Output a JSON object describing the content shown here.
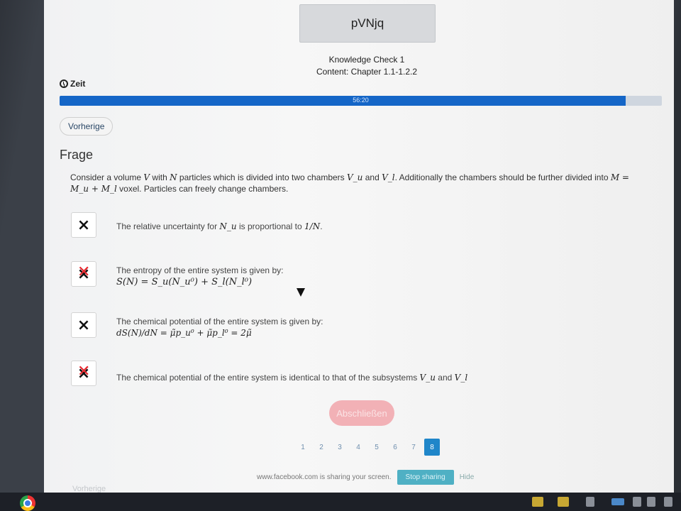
{
  "header": {
    "title": "pVNjq",
    "subtitle1": "Knowledge Check 1",
    "subtitle2": "Content: Chapter 1.1-1.2.2"
  },
  "timer": {
    "label": "Zeit",
    "time_left": "56:20",
    "progress_fraction": 0.94
  },
  "nav": {
    "previous_label": "Vorherige"
  },
  "question": {
    "heading": "Frage",
    "text_parts": [
      "Consider a volume ",
      "V",
      " with ",
      "N",
      " particles which is divided into two chambers ",
      "V_u",
      " and ",
      "V_l",
      ". Additionally the chambers should be further divided into ",
      "M =",
      "M_u + M_l",
      " voxel. Particles can freely change chambers."
    ]
  },
  "options": [
    {
      "marker": "×",
      "text": "The relative uncertainty for ",
      "math": "N_u",
      "text2": " is proportional to ",
      "math2": "1/N",
      "text3": ".",
      "wrong": false
    },
    {
      "marker": "×",
      "text": "The entropy of the entire system is given by:",
      "math": "S(N) = S_u(N_u⁰) + S_l(N_l⁰)",
      "wrong": true
    },
    {
      "marker": "×",
      "text": "The chemical potential of the entire system is given by:",
      "math": "dS(N)/dN = μ̃p_u⁰ + μ̃p_l⁰ = 2μ̃",
      "wrong": false
    },
    {
      "marker": "×",
      "text": "The chemical potential of the entire system is identical to that of the subsystems ",
      "math": "V_u",
      "text2": " and ",
      "math2": "V_l",
      "wrong": true
    }
  ],
  "submit_label": "Abschließen",
  "pages": [
    "1",
    "2",
    "3",
    "4",
    "5",
    "6",
    "7",
    "8"
  ],
  "active_page": "8",
  "share": {
    "message": "www.facebook.com is sharing your screen.",
    "stop_label": "Stop sharing",
    "hide_label": "Hide"
  },
  "ghost_prev": "Vorherige"
}
